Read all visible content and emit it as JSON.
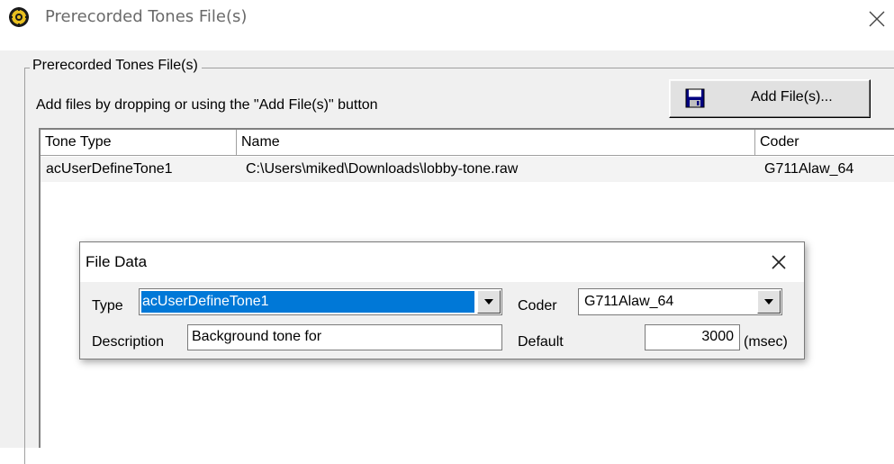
{
  "window": {
    "title": "Prerecorded Tones File(s)",
    "icon": "app-gear-icon",
    "close_icon": "close-icon"
  },
  "group": {
    "legend": "Prerecorded Tones File(s)",
    "hint": "Add files by dropping or using the \"Add File(s)\" button",
    "add_button_label": "Add File(s)...",
    "add_button_icon": "floppy-disk-icon"
  },
  "list": {
    "columns": [
      "Tone Type",
      "Name",
      "Coder"
    ],
    "rows": [
      {
        "tone_type": "acUserDefineTone1",
        "name": "C:\\Users\\miked\\Downloads\\lobby-tone.raw",
        "coder": "G711Alaw_64"
      }
    ]
  },
  "file_data_dialog": {
    "title": "File Data",
    "type_label": "Type",
    "type_value": "acUserDefineTone1",
    "coder_label": "Coder",
    "coder_value": "G711Alaw_64",
    "description_label": "Description",
    "description_value": "Background tone for",
    "default_label": "Default",
    "default_value": "3000",
    "default_unit": "(msec)"
  },
  "colors": {
    "selection": "#0078d7",
    "dialog_bg": "#f0f0f0",
    "title_text": "#6a6a6a"
  }
}
